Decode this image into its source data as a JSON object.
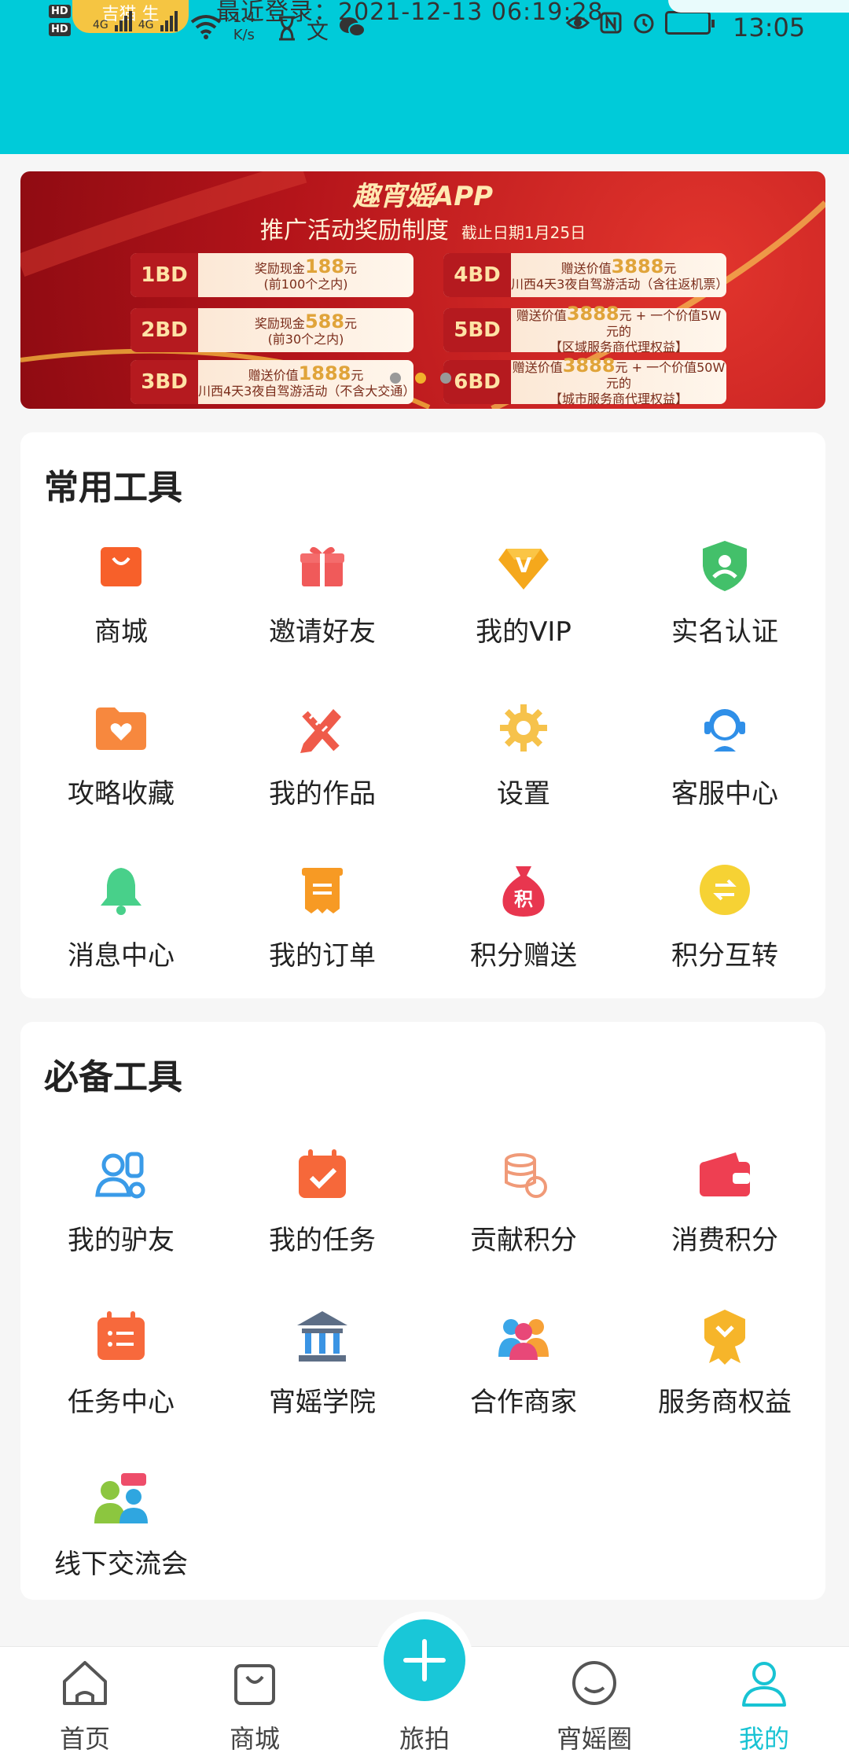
{
  "status": {
    "hd1": "HD",
    "hd2": "HD",
    "pill_text": "吉猫 生",
    "net1": "4G",
    "net2": "4G",
    "speed": "1.4\nK/s",
    "last_login": "最近登录：2021-12-13 06:19:28",
    "time": "13:05"
  },
  "banner": {
    "title": "趣宵媱APP",
    "subtitle": "推广活动奖励制度",
    "deadline": "截止日期1月25日",
    "rows": [
      {
        "level": "1BD",
        "text": "奖励现金",
        "amount": "188",
        "unit": "元",
        "note": "(前100个之内)"
      },
      {
        "level": "2BD",
        "text": "奖励现金",
        "amount": "588",
        "unit": "元",
        "note": "(前30个之内)"
      },
      {
        "level": "3BD",
        "text": "赠送价值",
        "amount": "1888",
        "unit": "元",
        "note": "川西4天3夜自驾游活动（不含大交通）"
      },
      {
        "level": "4BD",
        "text": "赠送价值",
        "amount": "3888",
        "unit": "元",
        "note": "川西4天3夜自驾游活动（含往返机票）"
      },
      {
        "level": "5BD",
        "text": "赠送价值",
        "amount": "3888",
        "unit": "元 + 一个价值5W元的",
        "note": "【区域服务商代理权益】"
      },
      {
        "level": "6BD",
        "text": "赠送价值",
        "amount": "3888",
        "unit": "元 + 一个价值50W元的",
        "note": "【城市服务商代理权益】"
      }
    ],
    "active_slide": 2
  },
  "common_tools": {
    "title": "常用工具",
    "items": [
      {
        "label": "商城",
        "icon": "shopping-bag-icon"
      },
      {
        "label": "邀请好友",
        "icon": "gift-icon"
      },
      {
        "label": "我的VIP",
        "icon": "vip-diamond-icon"
      },
      {
        "label": "实名认证",
        "icon": "verified-shield-icon"
      },
      {
        "label": "攻略收藏",
        "icon": "heart-folder-icon"
      },
      {
        "label": "我的作品",
        "icon": "pencil-ruler-icon"
      },
      {
        "label": "设置",
        "icon": "gear-icon"
      },
      {
        "label": "客服中心",
        "icon": "customer-service-icon"
      },
      {
        "label": "消息中心",
        "icon": "bell-icon"
      },
      {
        "label": "我的订单",
        "icon": "order-icon"
      },
      {
        "label": "积分赠送",
        "icon": "points-bag-icon"
      },
      {
        "label": "积分互转",
        "icon": "exchange-icon"
      }
    ],
    "points_glyph": "积"
  },
  "essential_tools": {
    "title": "必备工具",
    "items": [
      {
        "label": "我的驴友",
        "icon": "friends-icon"
      },
      {
        "label": "我的任务",
        "icon": "calendar-check-icon"
      },
      {
        "label": "贡献积分",
        "icon": "coins-icon"
      },
      {
        "label": "消费积分",
        "icon": "wallet-icon"
      },
      {
        "label": "任务中心",
        "icon": "task-list-icon"
      },
      {
        "label": "宵媱学院",
        "icon": "academy-icon"
      },
      {
        "label": "合作商家",
        "icon": "partners-icon"
      },
      {
        "label": "服务商权益",
        "icon": "badge-icon"
      },
      {
        "label": "线下交流会",
        "icon": "meetup-icon"
      }
    ]
  },
  "bottom_nav": {
    "items": [
      {
        "label": "首页",
        "icon": "home-icon"
      },
      {
        "label": "商城",
        "icon": "shopping-bag-icon"
      },
      {
        "label": "旅拍",
        "icon": "plus-icon"
      },
      {
        "label": "宵媱圈",
        "icon": "smile-icon"
      },
      {
        "label": "我的",
        "icon": "user-icon"
      }
    ],
    "active": "我的"
  },
  "colors": {
    "header": "#00cbd9",
    "accent": "#18c3d3"
  }
}
